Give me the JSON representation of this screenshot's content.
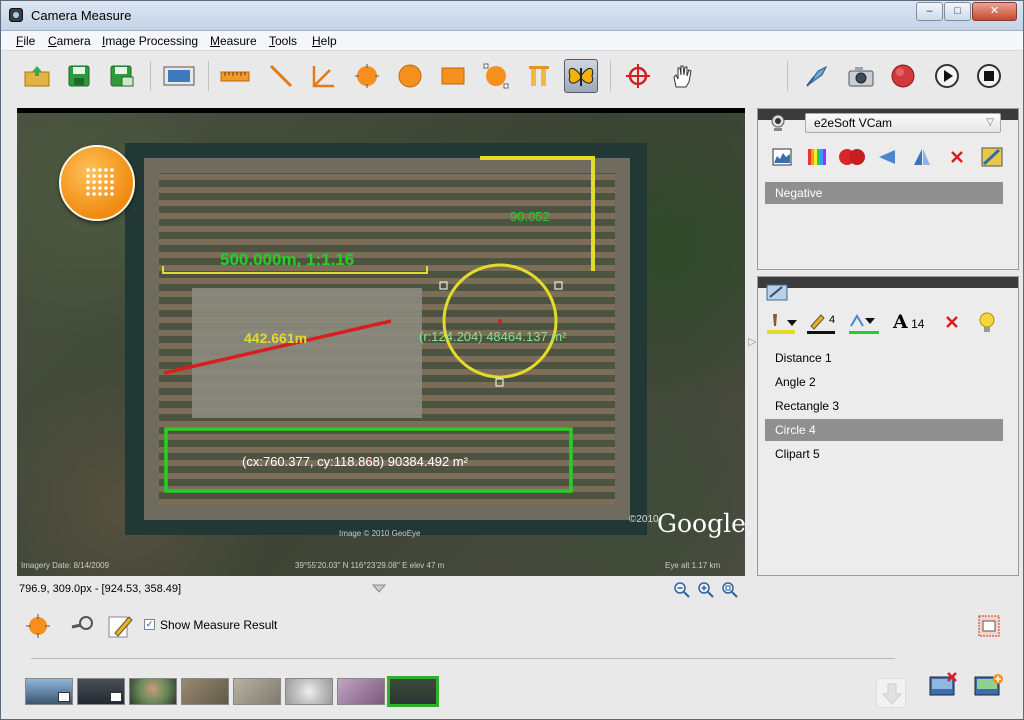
{
  "window": {
    "title": "Camera Measure",
    "controls": {
      "minimize": "–",
      "maximize": "□",
      "close": "✕"
    }
  },
  "menu": [
    "File",
    "Camera",
    "Image Processing",
    "Measure",
    "Tools",
    "Help"
  ],
  "toolbar": {
    "tools": [
      "open-icon",
      "save-icon",
      "save-as-icon",
      "capture-frame-icon",
      "ruler-icon",
      "line-icon",
      "angle-icon",
      "point-circle-icon",
      "circle-icon",
      "rectangle-icon",
      "ellipse-icon",
      "columns-icon",
      "butterfly-icon",
      "crosshair-icon",
      "hand-icon",
      "calibrate-icon",
      "camera-icon",
      "record-icon",
      "play-icon",
      "stop-icon"
    ],
    "active": "butterfly-icon"
  },
  "overlays": {
    "scale_label": "500.000m, 1:1.16",
    "corner_value": "90.052",
    "distance_label": "442.661m",
    "circle_label": "(r:124.204) 48464.137 m²",
    "rect_label": "(cx:760.377, cy:118.868) 90384.492 m²",
    "google": "Google",
    "copyright": "Image © 2010 GeoEye",
    "imagery_date": "Imagery Date: 8/14/2009",
    "coords_footer": "39°55'20.03\" N 116°23'29.08\" E elev 47 m",
    "eye_alt": "Eye alt 1.17 km",
    "year": "©2010"
  },
  "camera_panel": {
    "device": "e2eSoft VCam",
    "filters": [
      "histogram-icon",
      "color-bars-icon",
      "red-balls-icon",
      "flip-horizontal-icon",
      "flip-vertical-icon",
      "remove-icon",
      "image-adjust-icon"
    ],
    "applied_filters": [
      "Negative"
    ]
  },
  "measure_panel": {
    "line_width": "4",
    "font_size": "14",
    "items": [
      "Distance 1",
      "Angle 2",
      "Rectangle 3",
      "Circle 4",
      "Clipart 5"
    ],
    "selected": "Circle 4"
  },
  "status": {
    "position": "796.9, 309.0px - [924.53, 358.49]"
  },
  "bottom": {
    "show_measure_label": "Show Measure Result",
    "show_measure_checked": true
  },
  "colors": {
    "yellow": "#e3dc2a",
    "green": "#24d024",
    "red": "#d62020",
    "white": "#ffffff"
  }
}
